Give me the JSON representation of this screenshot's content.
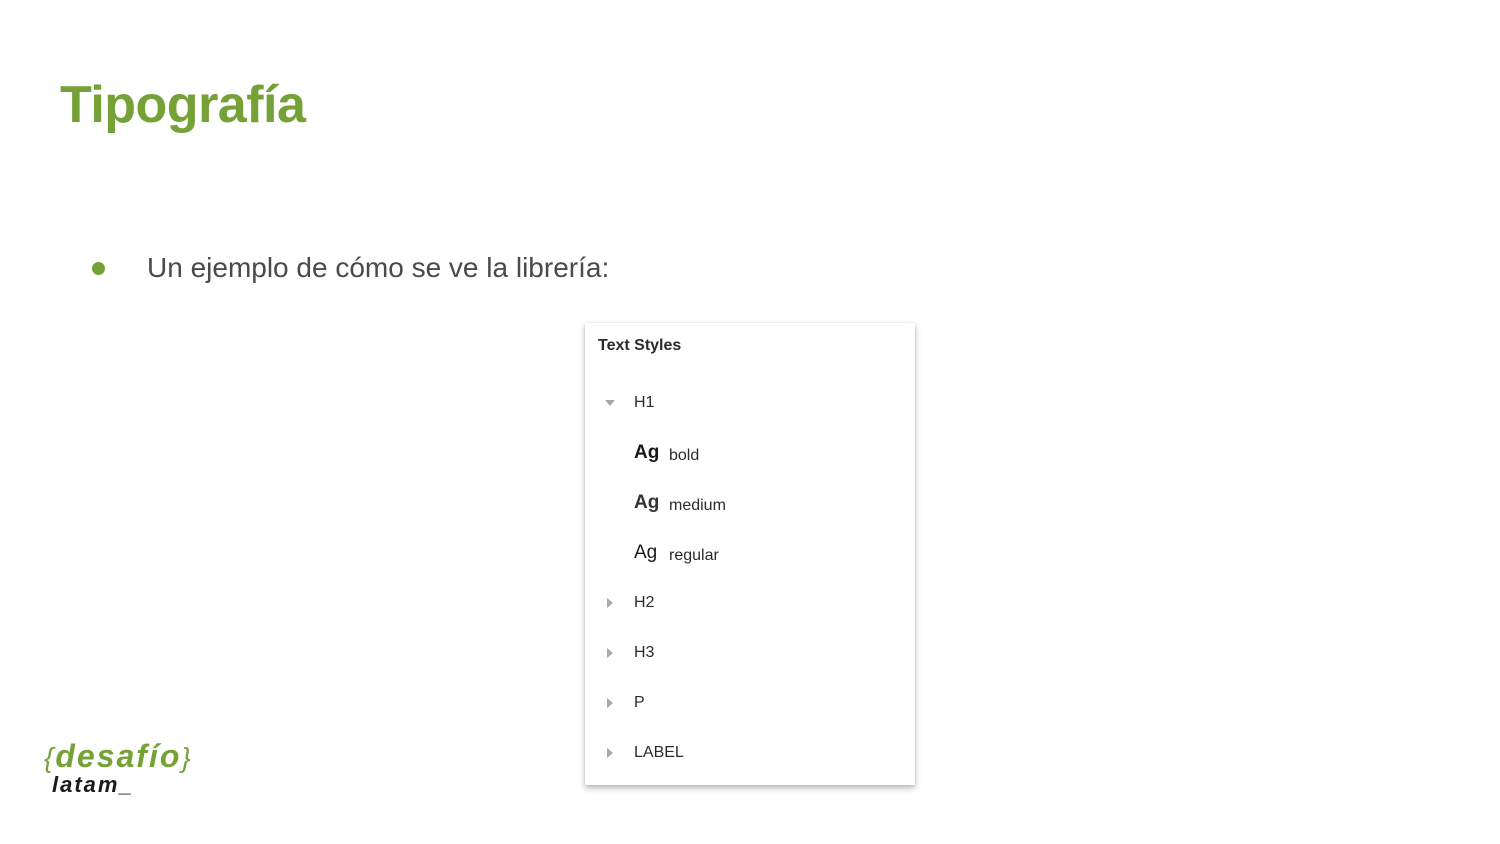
{
  "slide": {
    "title": "Tipografía",
    "bullet": "Un ejemplo de cómo se ve la librería:"
  },
  "colors": {
    "accent": "#75a136",
    "body_text": "#4a4a4a",
    "panel_text": "#2b2b2b"
  },
  "panel": {
    "header": "Text Styles",
    "groups": [
      {
        "label": "H1",
        "expanded": true,
        "icon": "caret-down-icon",
        "styles": [
          {
            "sample": "Ag",
            "name": "bold",
            "weight": "bold"
          },
          {
            "sample": "Ag",
            "name": "medium",
            "weight": "medium"
          },
          {
            "sample": "Ag",
            "name": "regular",
            "weight": "regular"
          }
        ]
      },
      {
        "label": "H2",
        "expanded": false,
        "icon": "caret-right-icon"
      },
      {
        "label": "H3",
        "expanded": false,
        "icon": "caret-right-icon"
      },
      {
        "label": "P",
        "expanded": false,
        "icon": "caret-right-icon"
      },
      {
        "label": "LABEL",
        "expanded": false,
        "icon": "caret-right-icon"
      }
    ]
  },
  "logo": {
    "open_brace": "{",
    "word": "desafío",
    "close_brace": "}",
    "sub": "latam_"
  }
}
